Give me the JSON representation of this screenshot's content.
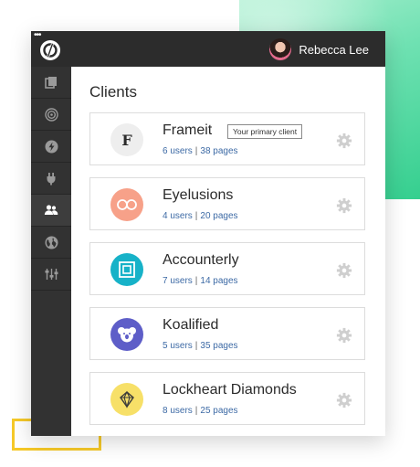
{
  "user": {
    "name": "Rebecca Lee"
  },
  "page": {
    "title": "Clients"
  },
  "sidebar": {
    "items": [
      {
        "icon": "pages-icon"
      },
      {
        "icon": "target-icon"
      },
      {
        "icon": "lightning-icon"
      },
      {
        "icon": "plug-icon"
      },
      {
        "icon": "users-icon",
        "active": true
      },
      {
        "icon": "globe-icon"
      },
      {
        "icon": "sliders-icon"
      }
    ]
  },
  "clients": [
    {
      "name": "Frameit",
      "users": "6 users",
      "pages": "38 pages",
      "badge": "Your primary client",
      "icon_letter": "F",
      "color": "#eeeeee"
    },
    {
      "name": "Eyelusions",
      "users": "4 users",
      "pages": "20 pages",
      "color": "#f7a189"
    },
    {
      "name": "Accounterly",
      "users": "7 users",
      "pages": "14 pages",
      "color": "#17b2c8"
    },
    {
      "name": "Koalified",
      "users": "5 users",
      "pages": "35 pages",
      "color": "#5e5ec8"
    },
    {
      "name": "Lockheart Diamonds",
      "users": "8 users",
      "pages": "25 pages",
      "color": "#f7e068"
    }
  ],
  "colors": {
    "topbar": "#2c2c2c",
    "sidebar": "#323232",
    "link": "#3d6aa5",
    "accent_green": "#35cf8f",
    "accent_yellow": "#f6c928"
  }
}
